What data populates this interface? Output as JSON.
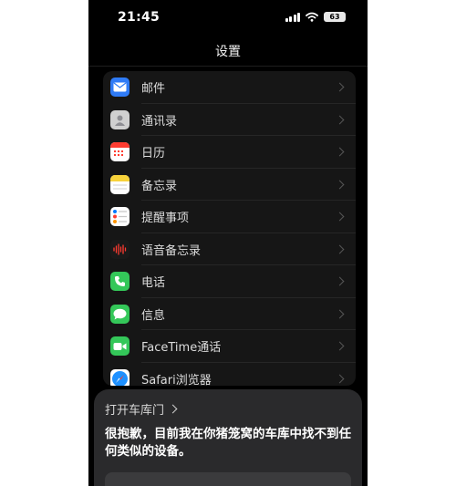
{
  "status_bar": {
    "time": "21:45",
    "battery": "63"
  },
  "nav": {
    "title": "设置"
  },
  "settings_items": [
    {
      "label": "邮件",
      "icon": "mail-icon",
      "color": "#2f7bf6"
    },
    {
      "label": "通讯录",
      "icon": "contacts-icon",
      "color": "#d0d0d0"
    },
    {
      "label": "日历",
      "icon": "calendar-icon",
      "color": "#ffffff"
    },
    {
      "label": "备忘录",
      "icon": "notes-icon",
      "color": "#f7d23a"
    },
    {
      "label": "提醒事项",
      "icon": "reminders-icon",
      "color": "#ffffff"
    },
    {
      "label": "语音备忘录",
      "icon": "voice-memos-icon",
      "color": "#1a1a1a"
    },
    {
      "label": "电话",
      "icon": "phone-icon",
      "color": "#34c759"
    },
    {
      "label": "信息",
      "icon": "messages-icon",
      "color": "#34c759"
    },
    {
      "label": "FaceTime通话",
      "icon": "facetime-icon",
      "color": "#34c759"
    },
    {
      "label": "Safari浏览器",
      "icon": "safari-icon",
      "color": "#1e90ff"
    }
  ],
  "siri_card": {
    "header": "打开车库门",
    "message": "很抱歉，目前我在你猪笼窝的车库中找不到任何类似的设备。"
  },
  "colors": {
    "background": "#000000",
    "accent": "#34c759",
    "card": "#2a2a2c"
  }
}
